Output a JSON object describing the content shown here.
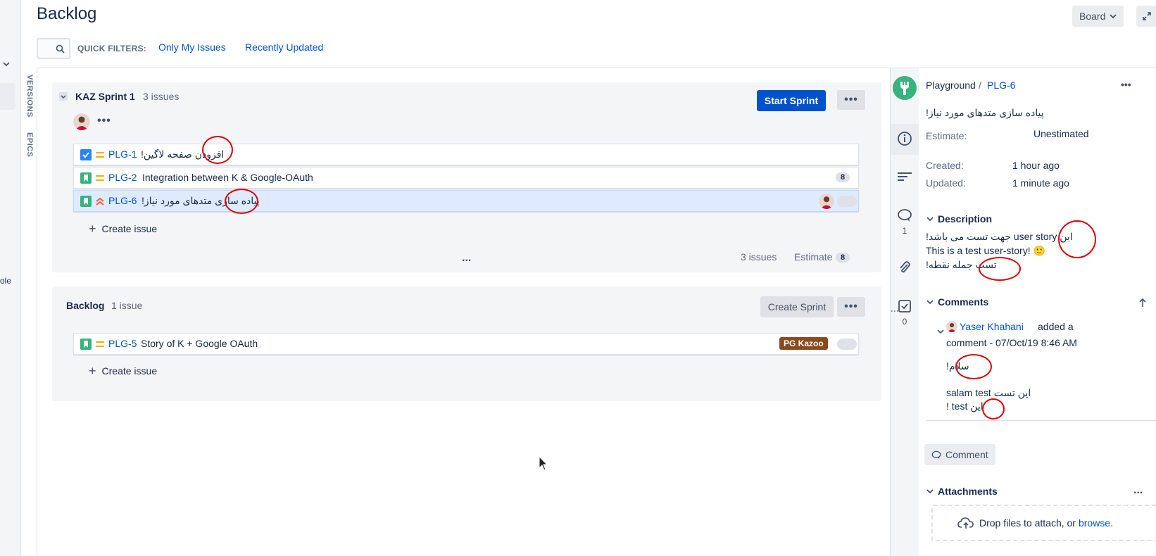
{
  "header": {
    "title": "Backlog",
    "board_button": "Board",
    "quick_filters_label": "QUICK FILTERS:",
    "filters": [
      "Only My Issues",
      "Recently Updated"
    ]
  },
  "side_tabs": {
    "versions": "VERSIONS",
    "epics": "EPICS"
  },
  "left_partial_text": "ole",
  "sprint": {
    "name": "KAZ Sprint 1",
    "issue_count": "3 issues",
    "start_button": "Start Sprint",
    "more": "•••",
    "issues": [
      {
        "key": "PLG-1",
        "summary": "افزودن صفحه لاگین!",
        "type": "task",
        "priority": "medium",
        "estimate": ""
      },
      {
        "key": "PLG-2",
        "summary": "Integration between K & Google-OAuth",
        "type": "story",
        "priority": "medium",
        "estimate": "8"
      },
      {
        "key": "PLG-6",
        "summary": "پیاده سازی متدهای مورد نیاز!",
        "type": "story",
        "priority": "highest",
        "estimate": ""
      }
    ],
    "create_issue": "Create issue",
    "ellipsis": "...",
    "footer_issues": "3 issues",
    "footer_estimate_label": "Estimate",
    "footer_estimate_value": "8"
  },
  "backlog": {
    "name": "Backlog",
    "issue_count": "1 issue",
    "create_sprint_button": "Create Sprint",
    "more": "•••",
    "issues": [
      {
        "key": "PLG-5",
        "summary": "Story of K + Google OAuth",
        "type": "story",
        "priority": "medium",
        "epic": "PG Kazoo"
      }
    ],
    "create_issue": "Create issue"
  },
  "detail": {
    "project": "Playground",
    "separator": "/",
    "issue_key": "PLG-6",
    "more": "•••",
    "title": "پیاده سازی متدهای مورد نیاز!",
    "estimate_label": "Estimate:",
    "estimate_value": "Unestimated",
    "created_label": "Created:",
    "created_value": "1 hour ago",
    "updated_label": "Updated:",
    "updated_value": "1 minute ago",
    "comments_rail_count": "1",
    "subtasks_rail_count": "0",
    "description_title": "Description",
    "description_lines": [
      "این user story جهت تست می باشد!",
      "This is a test user-story! 🙂",
      "تست جمله نقطه!"
    ],
    "comments_title": "Comments",
    "comment": {
      "author": "Yaser Khahani",
      "action": "added a",
      "meta": "comment - 07/Oct/19 8:46 AM",
      "body_lines": [
        "سلام!",
        "",
        "salam test این تست",
        "این test !"
      ]
    },
    "comment_button": "Comment",
    "attachments_title": "Attachments",
    "attachments_more": "...",
    "drop_text": "Drop files to attach, or",
    "browse_link": "browse."
  },
  "colors": {
    "primary": "#0052cc",
    "panel_bg": "#f4f5f7",
    "selected_row": "#deebff",
    "story_green": "#36b37e",
    "task_blue": "#4bade8",
    "priority_medium": "#ffab00",
    "priority_highest": "#ff5630",
    "epic_brown": "#8b4a1e",
    "annotation_red": "#e00000"
  }
}
